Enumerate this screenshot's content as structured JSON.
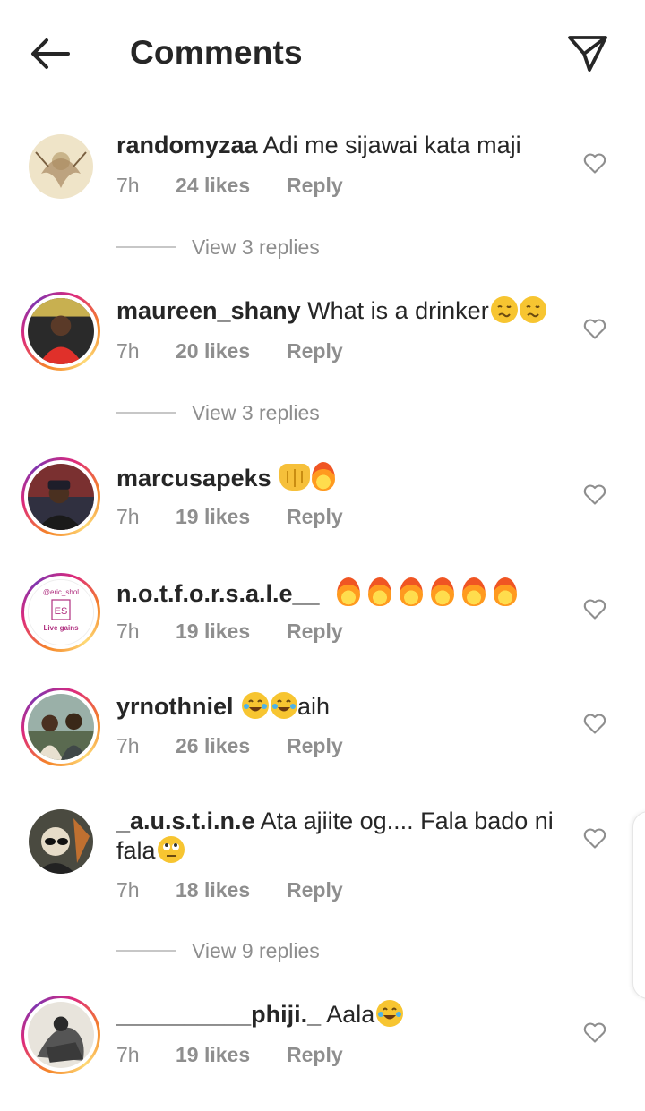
{
  "header": {
    "title": "Comments",
    "back_icon": "arrow-left-icon",
    "share_icon": "paper-plane-icon"
  },
  "comments": [
    {
      "username": "randomyzaa",
      "text": "Adi me sijawai kata maji",
      "time": "7h",
      "likes": "24 likes",
      "reply": "Reply",
      "emojis": [],
      "view_replies": "View 3 replies",
      "story_ring": false
    },
    {
      "username": "maureen_shany",
      "text": "What is a drinker",
      "time": "7h",
      "likes": "20 likes",
      "reply": "Reply",
      "emojis": [
        "woozy-face",
        "woozy-face"
      ],
      "view_replies": "View 3 replies",
      "story_ring": true
    },
    {
      "username": "marcusapeks",
      "text": "",
      "time": "7h",
      "likes": "19 likes",
      "reply": "Reply",
      "emojis": [
        "raising-hands",
        "fire"
      ],
      "story_ring": true
    },
    {
      "username": "n.o.t.f.o.r.s.a.l.e__",
      "text": "",
      "time": "7h",
      "likes": "19 likes",
      "reply": "Reply",
      "emojis": [
        "fire",
        "fire",
        "fire",
        "fire",
        "fire",
        "fire"
      ],
      "story_ring": true,
      "avatar_text": [
        "@eric_shol",
        "ES",
        "Live gains"
      ]
    },
    {
      "username": "yrnothniel",
      "text": "aih",
      "time": "7h",
      "likes": "26 likes",
      "reply": "Reply",
      "emojis": [
        "tears-of-joy",
        "tears-of-joy"
      ],
      "story_ring": true
    },
    {
      "username": "_a.u.s.t.i.n.e",
      "text": "Ata ajiite og.... Fala bado ni",
      "text_line2": "fala",
      "time": "7h",
      "likes": "18 likes",
      "reply": "Reply",
      "emojis": [
        "face-with-rolling-eyes"
      ],
      "view_replies": "View 9 replies",
      "story_ring": false
    },
    {
      "username": "__________phiji._",
      "text": "Aala",
      "time": "7h",
      "likes": "19 likes",
      "reply": "Reply",
      "emojis": [
        "tears-of-joy"
      ],
      "story_ring": true
    }
  ],
  "colors": {
    "text": "#262626",
    "secondary": "#8e8e8e",
    "divider": "#c7c7c7",
    "ring_gradient": [
      "#f58529",
      "#dd2a7b",
      "#8134af",
      "#feda77"
    ]
  }
}
